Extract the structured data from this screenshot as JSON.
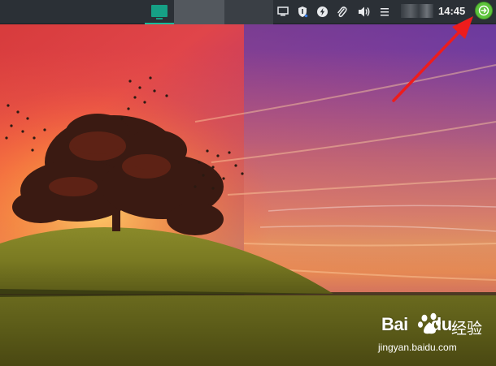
{
  "panel": {
    "clock": "14:45",
    "tray_icons": [
      "monitor-icon",
      "shield-icon",
      "lightning-icon",
      "paperclip-icon",
      "speaker-icon",
      "menu-icon"
    ],
    "accent_color": "#1abc9c",
    "logout_button_color": "#5cc33b"
  },
  "annotation": {
    "arrow_color": "#ee1c1c"
  },
  "watermark": {
    "brand_text": "Bai",
    "brand_text_tail": "du",
    "cn_text": "经验",
    "url": "jingyan.baidu.com"
  }
}
